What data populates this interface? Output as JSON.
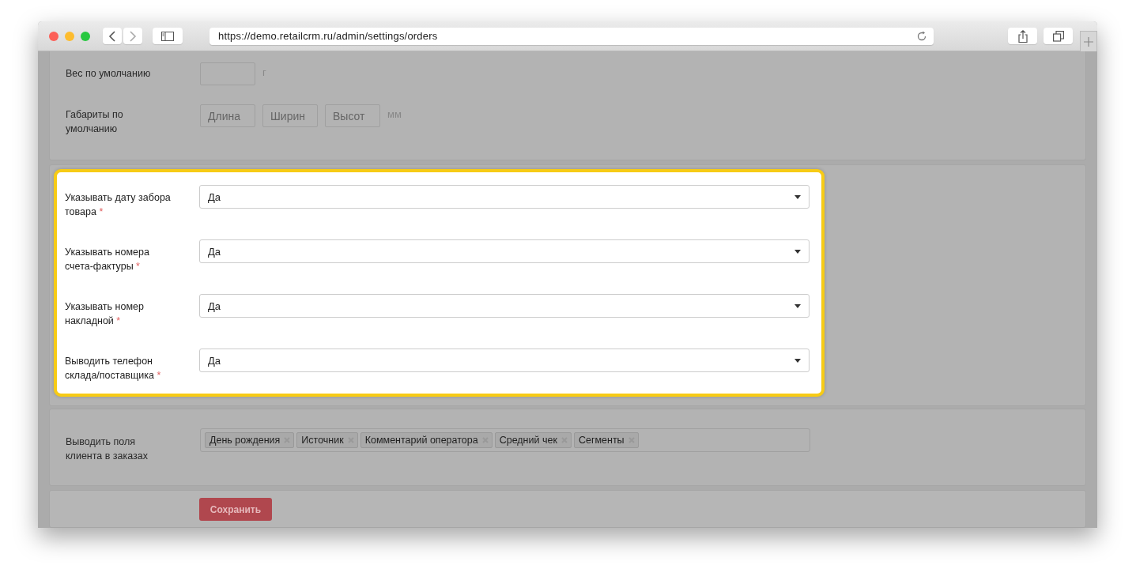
{
  "browser": {
    "url": "https://demo.retailcrm.ru/admin/settings/orders"
  },
  "weight": {
    "label": "Вес по умолчанию",
    "unit": "г"
  },
  "dimensions": {
    "label": "Габариты по умолчанию",
    "placeholders": [
      "Длина",
      "Ширин",
      "Высот"
    ],
    "unit": "мм"
  },
  "highlighted_settings": [
    {
      "label": "Указывать дату забора товара",
      "required": true,
      "required_mark": "*",
      "value": "Да"
    },
    {
      "label": "Указывать номера счета-фактуры",
      "required": true,
      "required_mark": "*",
      "value": "Да"
    },
    {
      "label": "Указывать номер накладной",
      "required": true,
      "required_mark": "*",
      "value": "Да"
    },
    {
      "label": "Выводить телефон склада/поставщика",
      "required": true,
      "required_mark": "*",
      "value": "Да"
    }
  ],
  "client_fields": {
    "label": "Выводить поля клиента в заказах",
    "tags": [
      "День рождения",
      "Источник",
      "Комментарий оператора",
      "Средний чек",
      "Сегменты"
    ]
  },
  "save_button": "Сохранить"
}
